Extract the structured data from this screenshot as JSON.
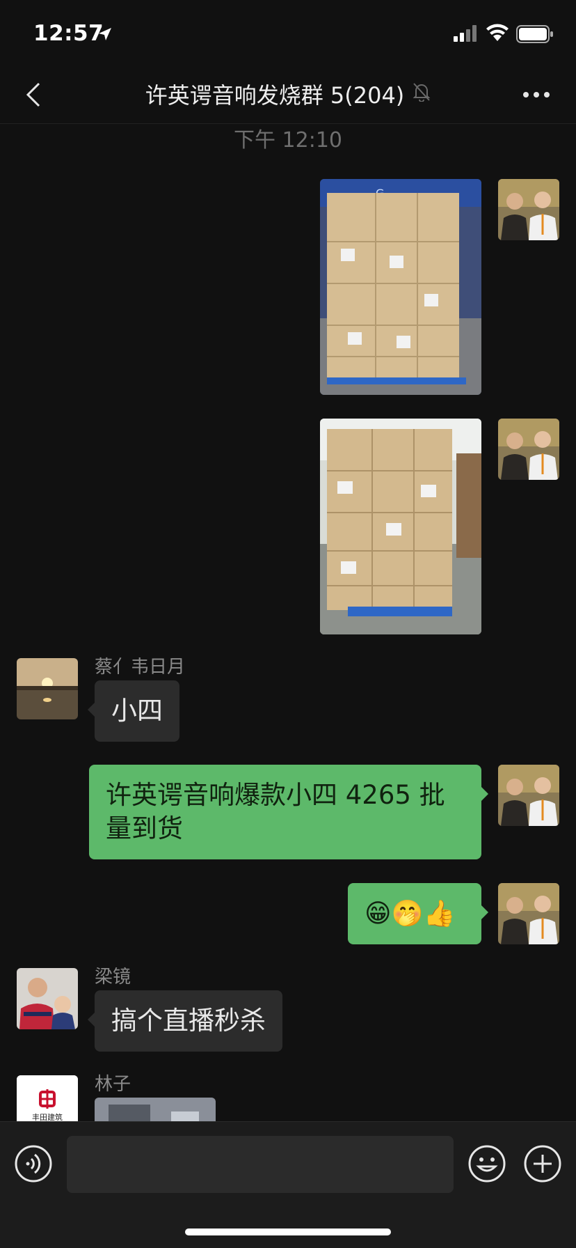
{
  "status_bar": {
    "time": "12:57",
    "icons": [
      "location-arrow-icon",
      "signal-icon",
      "wifi-icon",
      "battery-icon"
    ]
  },
  "header": {
    "title": "许英谔音响发烧群 5(204)",
    "back_icon": "chevron-left-icon",
    "mute_icon": "bell-off-icon",
    "more_icon": "more-dots-icon"
  },
  "chat": {
    "timestamp": "下午 12:10",
    "messages": [
      {
        "sender": "me",
        "type": "image",
        "content": "pallet of cardboard boxes photo"
      },
      {
        "sender": "me",
        "type": "image",
        "content": "stack of boxes on blue pallet photo"
      },
      {
        "sender": "蔡亻韦日月",
        "type": "text",
        "text": "小四"
      },
      {
        "sender": "me",
        "type": "text",
        "text": "许英谔音响爆款小四 4265 批量到货"
      },
      {
        "sender": "me",
        "type": "text",
        "text": "😁🤭👍"
      },
      {
        "sender": "梁镜",
        "type": "text",
        "text": "搞个直播秒杀"
      },
      {
        "sender": "林子",
        "type": "image",
        "content": "photo"
      }
    ],
    "names": {
      "cai": "蔡亻韦日月",
      "liang": "梁镜",
      "lin": "林子"
    },
    "avatar_text": {
      "lin_logo": "丰田建筑"
    }
  },
  "input_bar": {
    "placeholder": "",
    "voice_icon": "voice-icon",
    "emoji_icon": "emoji-icon",
    "plus_icon": "plus-icon"
  },
  "colors": {
    "background": "#111111",
    "bubble_out": "#5db96a",
    "bubble_in": "#2c2c2c"
  }
}
